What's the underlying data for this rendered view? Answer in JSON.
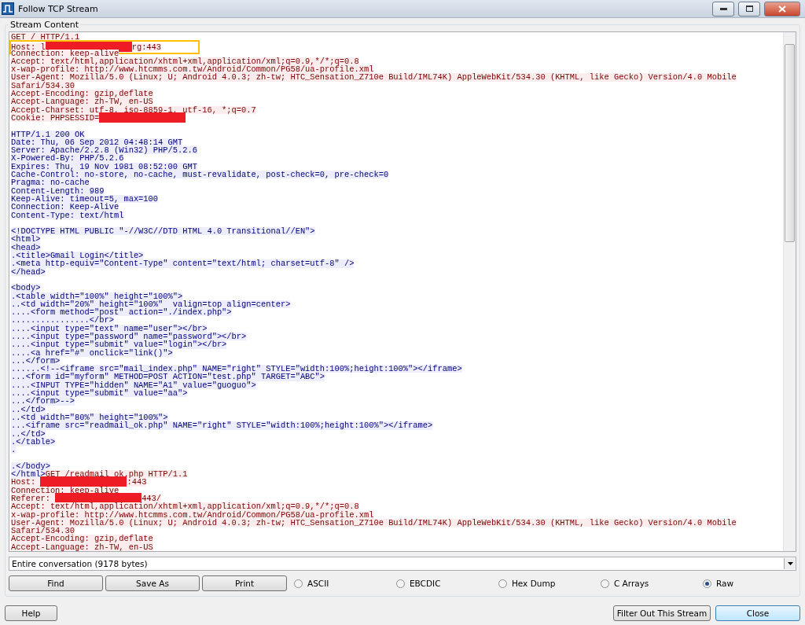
{
  "window": {
    "title": "Follow TCP Stream"
  },
  "stream": {
    "label": "Stream Content",
    "blocks": [
      {
        "lines": [
          {
            "segments": [
              {
                "kind": "client",
                "text": "GET / HTTP/1.1"
              }
            ]
          },
          {
            "highlighted": true,
            "segments": [
              {
                "kind": "client",
                "text": "Host: l"
              },
              {
                "kind": "redaction"
              },
              {
                "kind": "client",
                "text": "rg:443"
              }
            ]
          },
          {
            "segments": [
              {
                "kind": "client",
                "text": "Connection: keep-alive"
              }
            ]
          },
          {
            "segments": [
              {
                "kind": "client",
                "text": "Accept: text/html,application/xhtml+xml,application/xml;q=0.9,*/*;q=0.8"
              }
            ]
          },
          {
            "segments": [
              {
                "kind": "client",
                "text": "x-wap-profile: http://www.htcmms.com.tw/Android/Common/PG58/ua-profile.xml"
              }
            ]
          },
          {
            "segments": [
              {
                "kind": "client",
                "text": "User-Agent: Mozilla/5.0 (Linux; U; Android 4.0.3; zh-tw; HTC_Sensation_Z710e Build/IML74K) AppleWebKit/534.30 (KHTML, like Gecko) Version/4.0 Mobile"
              }
            ]
          },
          {
            "segments": [
              {
                "kind": "client",
                "text": "Safari/534.30"
              }
            ]
          },
          {
            "segments": [
              {
                "kind": "client",
                "text": "Accept-Encoding: gzip,deflate"
              }
            ]
          },
          {
            "segments": [
              {
                "kind": "client",
                "text": "Accept-Language: zh-TW, en-US"
              }
            ]
          },
          {
            "segments": [
              {
                "kind": "client",
                "text": "Accept-Charset: utf-8, iso-8859-1, utf-16, *;q=0.7"
              }
            ]
          },
          {
            "segments": [
              {
                "kind": "client",
                "text": "Cookie: PHPSESSID="
              },
              {
                "kind": "redaction"
              }
            ]
          }
        ]
      },
      {
        "lines": [
          {
            "segments": [
              {
                "kind": "server",
                "text": "HTTP/1.1 200 OK"
              }
            ]
          },
          {
            "segments": [
              {
                "kind": "server",
                "text": "Date: Thu, 06 Sep 2012 04:48:14 GMT"
              }
            ]
          },
          {
            "segments": [
              {
                "kind": "server",
                "text": "Server: Apache/2.2.8 (Win32) PHP/5.2.6"
              }
            ]
          },
          {
            "segments": [
              {
                "kind": "server",
                "text": "X-Powered-By: PHP/5.2.6"
              }
            ]
          },
          {
            "segments": [
              {
                "kind": "server",
                "text": "Expires: Thu, 19 Nov 1981 08:52:00 GMT"
              }
            ]
          },
          {
            "segments": [
              {
                "kind": "server",
                "text": "Cache-Control: no-store, no-cache, must-revalidate, post-check=0, pre-check=0"
              }
            ]
          },
          {
            "segments": [
              {
                "kind": "server",
                "text": "Pragma: no-cache"
              }
            ]
          },
          {
            "segments": [
              {
                "kind": "server",
                "text": "Content-Length: 989"
              }
            ]
          },
          {
            "segments": [
              {
                "kind": "server",
                "text": "Keep-Alive: timeout=5, max=100"
              }
            ]
          },
          {
            "segments": [
              {
                "kind": "server",
                "text": "Connection: Keep-Alive"
              }
            ]
          },
          {
            "segments": [
              {
                "kind": "server",
                "text": "Content-Type: text/html"
              }
            ]
          }
        ]
      },
      {
        "lines": [
          {
            "segments": [
              {
                "kind": "server",
                "text": "<!DOCTYPE HTML PUBLIC \"-//W3C//DTD HTML 4.0 Transitional//EN\">"
              }
            ]
          },
          {
            "segments": [
              {
                "kind": "server",
                "text": "<html>"
              }
            ]
          },
          {
            "segments": [
              {
                "kind": "server",
                "text": "<head>"
              }
            ]
          },
          {
            "segments": [
              {
                "kind": "server",
                "text": ".<title>Gmail Login</title>"
              }
            ]
          },
          {
            "segments": [
              {
                "kind": "server",
                "text": ".<meta http-equiv=\"Content-Type\" content=\"text/html; charset=utf-8\" />"
              }
            ]
          },
          {
            "segments": [
              {
                "kind": "server",
                "text": "</head>"
              }
            ]
          }
        ]
      },
      {
        "lines": [
          {
            "segments": [
              {
                "kind": "server",
                "text": "<body>"
              }
            ]
          },
          {
            "segments": [
              {
                "kind": "server",
                "text": ".<table width=\"100%\" height=\"100%\">"
              }
            ]
          },
          {
            "segments": [
              {
                "kind": "server",
                "text": "..<td width=\"20%\" height=\"100%\"  valign=top align=center>"
              }
            ]
          },
          {
            "segments": [
              {
                "kind": "server",
                "text": "....<form method=\"post\" action=\"./index.php\">"
              }
            ]
          },
          {
            "segments": [
              {
                "kind": "server",
                "text": "................</br>"
              }
            ]
          },
          {
            "segments": [
              {
                "kind": "server",
                "text": "....<input type=\"text\" name=\"user\"></br>"
              }
            ]
          },
          {
            "segments": [
              {
                "kind": "server",
                "text": "....<input type=\"password\" name=\"password\"></br>"
              }
            ]
          },
          {
            "segments": [
              {
                "kind": "server",
                "text": "....<input type=\"submit\" value=\"login\"></br>"
              }
            ]
          },
          {
            "segments": [
              {
                "kind": "server",
                "text": "....<a href=\"#\" onclick=\"link()\">"
              }
            ]
          },
          {
            "segments": [
              {
                "kind": "server",
                "text": "...</form>"
              }
            ]
          },
          {
            "segments": [
              {
                "kind": "server",
                "text": "......<!--<iframe src=\"mail_index.php\" NAME=\"right\" STYLE=\"width:100%;height:100%\"></iframe>"
              }
            ]
          },
          {
            "segments": [
              {
                "kind": "server",
                "text": "...<form id=\"myform\" METHOD=POST ACTION=\"test.php\" TARGET=\"ABC\">"
              }
            ]
          },
          {
            "segments": [
              {
                "kind": "server",
                "text": "....<INPUT TYPE=\"hidden\" NAME=\"A1\" value=\"guoguo\">"
              }
            ]
          },
          {
            "segments": [
              {
                "kind": "server",
                "text": "....<input type=\"submit\" value=\"aa\">"
              }
            ]
          },
          {
            "segments": [
              {
                "kind": "server",
                "text": "...</form>-->"
              }
            ]
          },
          {
            "segments": [
              {
                "kind": "server",
                "text": "..</td>"
              }
            ]
          },
          {
            "segments": [
              {
                "kind": "server",
                "text": "..<td width=\"80%\" height=\"100%\">"
              }
            ]
          },
          {
            "segments": [
              {
                "kind": "server",
                "text": "...<iframe src=\"readmail_ok.php\" NAME=\"right\" STYLE=\"width:100%;height:100%\"></iframe>"
              }
            ]
          },
          {
            "segments": [
              {
                "kind": "server",
                "text": "..</td>"
              }
            ]
          },
          {
            "segments": [
              {
                "kind": "server",
                "text": ".</table>"
              }
            ]
          },
          {
            "segments": [
              {
                "kind": "server",
                "text": "."
              }
            ]
          }
        ]
      },
      {
        "lines": [
          {
            "segments": [
              {
                "kind": "server",
                "text": ".</body>"
              }
            ]
          },
          {
            "segments": [
              {
                "kind": "server",
                "text": "</html>"
              },
              {
                "kind": "client",
                "text": "GET /readmail_ok.php HTTP/1.1"
              }
            ]
          },
          {
            "segments": [
              {
                "kind": "client",
                "text": "Host: "
              },
              {
                "kind": "redaction"
              },
              {
                "kind": "client",
                "text": ":443"
              }
            ]
          },
          {
            "segments": [
              {
                "kind": "client",
                "text": "Connection: keep-alive"
              }
            ]
          },
          {
            "segments": [
              {
                "kind": "client",
                "text": "Referer: "
              },
              {
                "kind": "redaction"
              },
              {
                "kind": "client",
                "text": "443/"
              }
            ]
          },
          {
            "segments": [
              {
                "kind": "client",
                "text": "Accept: text/html,application/xhtml+xml,application/xml;q=0.9,*/*;q=0.8"
              }
            ]
          },
          {
            "segments": [
              {
                "kind": "client",
                "text": "x-wap-profile: http://www.htcmms.com.tw/Android/Common/PG58/ua-profile.xml"
              }
            ]
          },
          {
            "segments": [
              {
                "kind": "client",
                "text": "User-Agent: Mozilla/5.0 (Linux; U; Android 4.0.3; zh-tw; HTC_Sensation_Z710e Build/IML74K) AppleWebKit/534.30 (KHTML, like Gecko) Version/4.0 Mobile"
              }
            ]
          },
          {
            "segments": [
              {
                "kind": "client",
                "text": "Safari/534.30"
              }
            ]
          },
          {
            "segments": [
              {
                "kind": "client",
                "text": "Accept-Encoding: gzip,deflate"
              }
            ]
          },
          {
            "segments": [
              {
                "kind": "client",
                "text": "Accept-Language: zh-TW, en-US"
              }
            ]
          }
        ]
      }
    ]
  },
  "conversation": {
    "value": "Entire conversation (9178 bytes)"
  },
  "actions": [
    "Find",
    "Save As",
    "Print"
  ],
  "formats": [
    {
      "label": "ASCII",
      "selected": false
    },
    {
      "label": "EBCDIC",
      "selected": false
    },
    {
      "label": "Hex Dump",
      "selected": false
    },
    {
      "label": "C Arrays",
      "selected": false
    },
    {
      "label": "Raw",
      "selected": true
    }
  ],
  "footer": {
    "help": "Help",
    "filter": "Filter Out This Stream",
    "close": "Close"
  }
}
